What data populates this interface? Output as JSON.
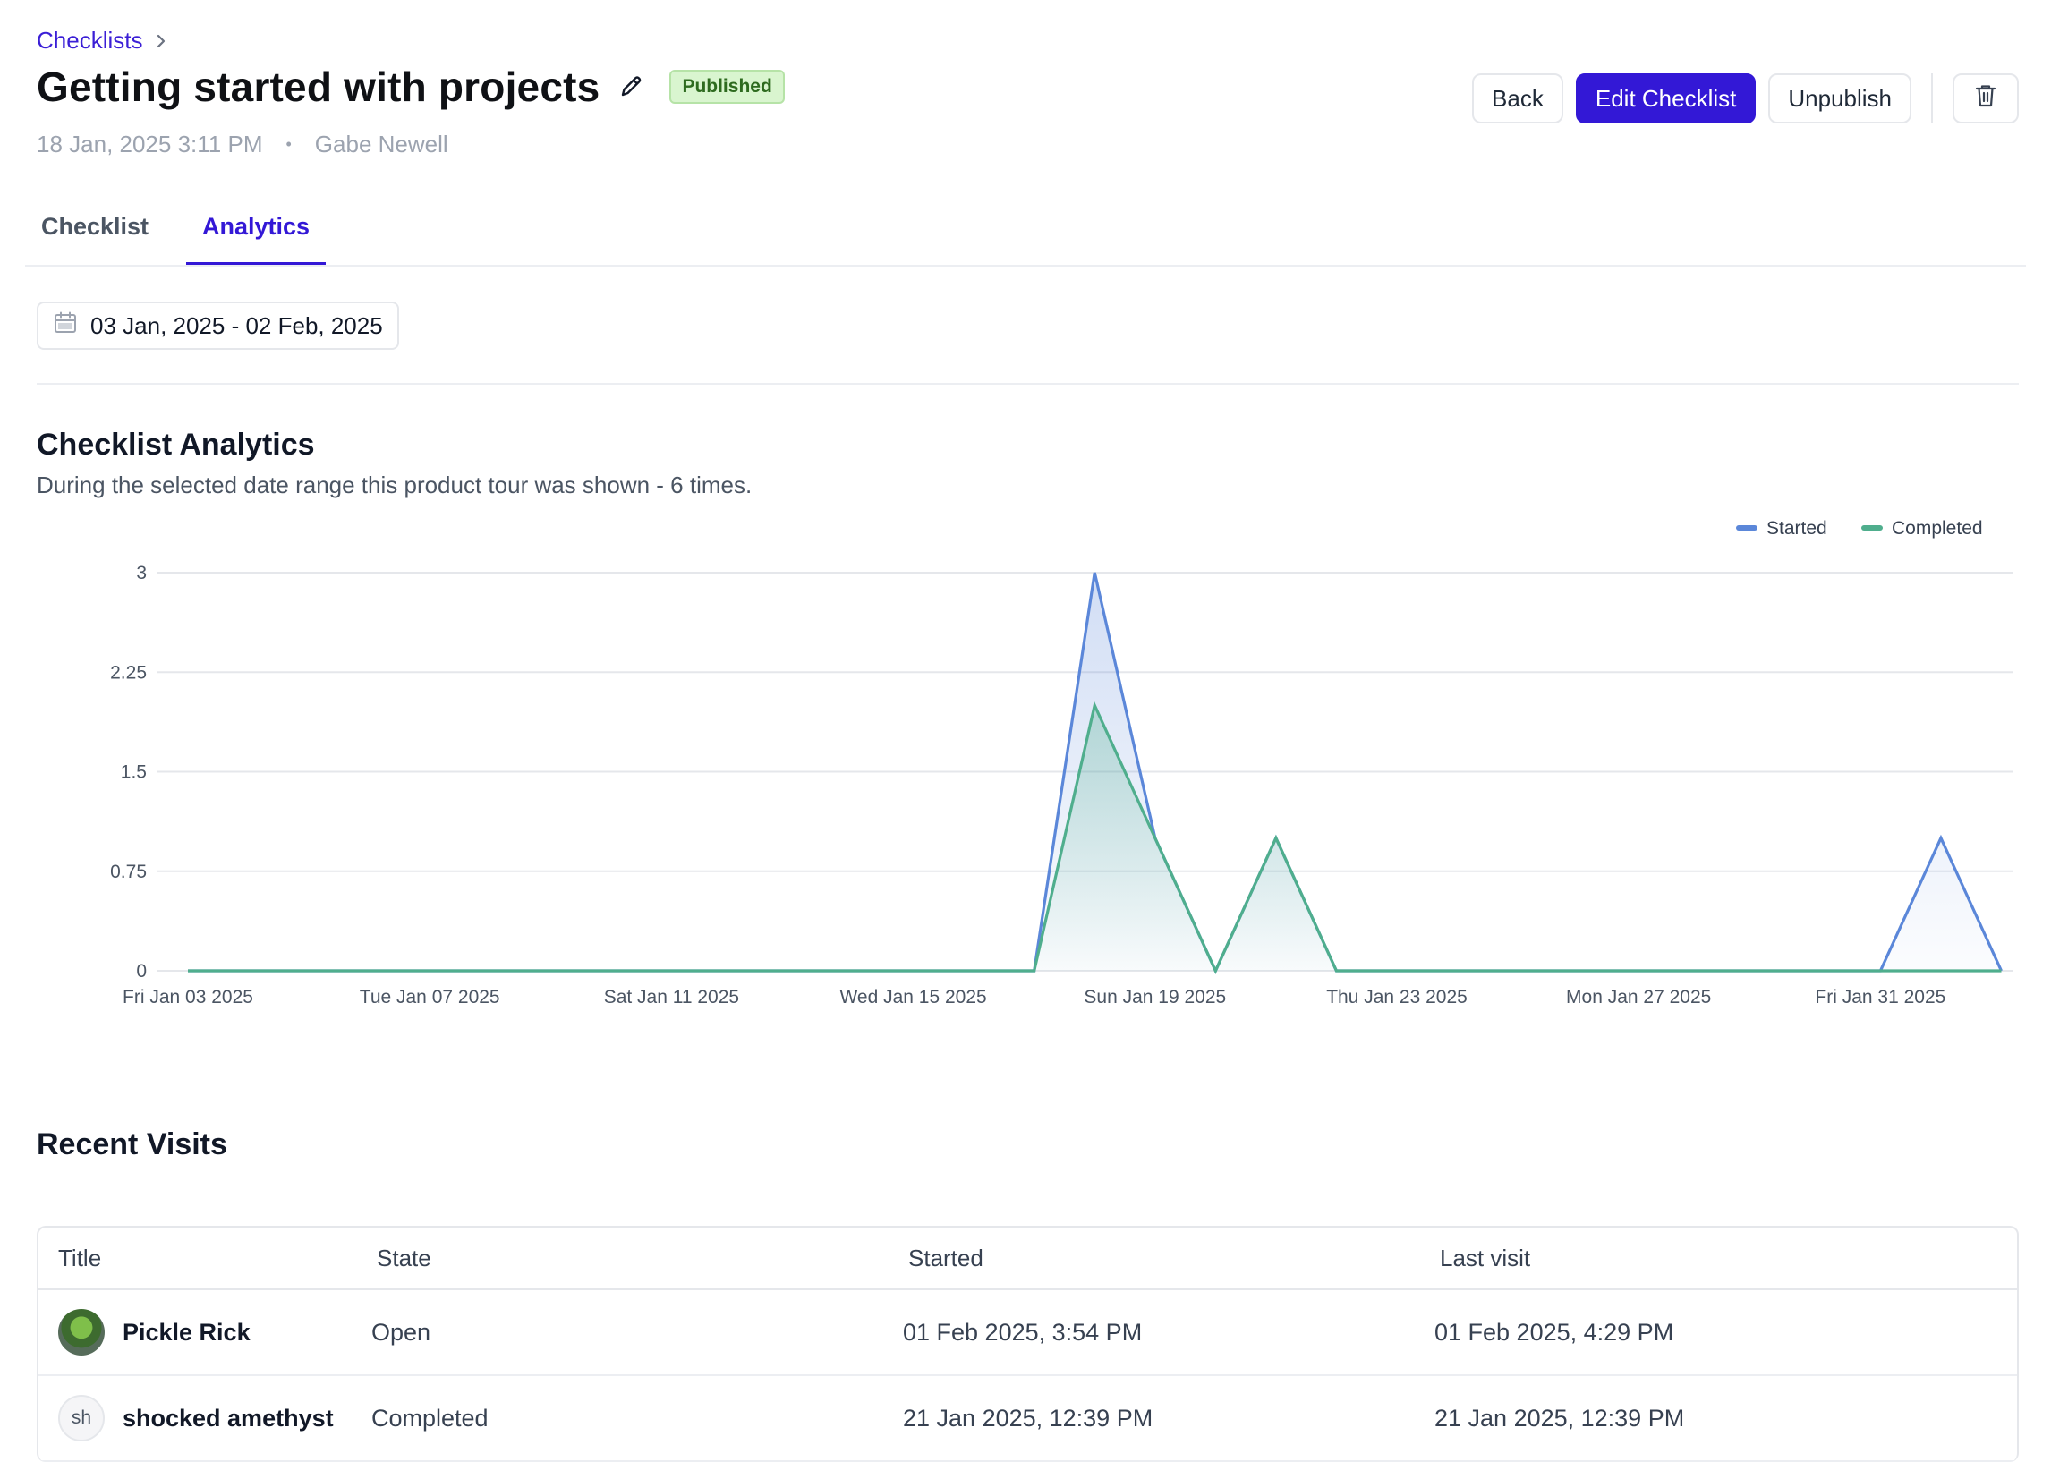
{
  "breadcrumb": {
    "label": "Checklists"
  },
  "header": {
    "title": "Getting started with projects",
    "status_badge": "Published",
    "date": "18 Jan, 2025 3:11 PM",
    "separator": "•",
    "author": "Gabe Newell"
  },
  "actions": {
    "back": "Back",
    "edit": "Edit Checklist",
    "unpublish": "Unpublish",
    "delete_icon": "trash-icon"
  },
  "tabs": [
    {
      "label": "Checklist",
      "active": false
    },
    {
      "label": "Analytics",
      "active": true
    }
  ],
  "date_range": {
    "value": "03 Jan, 2025 - 02 Feb, 2025",
    "icon": "calendar-icon"
  },
  "analytics": {
    "title": "Checklist Analytics",
    "subtitle": "During the selected date range this product tour was shown - 6 times."
  },
  "colors": {
    "accent": "#3318d6",
    "started": "#5b87d9",
    "completed": "#4fae8d"
  },
  "chart_data": {
    "type": "area",
    "x": [
      "2025-01-03",
      "2025-01-04",
      "2025-01-05",
      "2025-01-06",
      "2025-01-07",
      "2025-01-08",
      "2025-01-09",
      "2025-01-10",
      "2025-01-11",
      "2025-01-12",
      "2025-01-13",
      "2025-01-14",
      "2025-01-15",
      "2025-01-16",
      "2025-01-17",
      "2025-01-18",
      "2025-01-19",
      "2025-01-20",
      "2025-01-21",
      "2025-01-22",
      "2025-01-23",
      "2025-01-24",
      "2025-01-25",
      "2025-01-26",
      "2025-01-27",
      "2025-01-28",
      "2025-01-29",
      "2025-01-30",
      "2025-01-31",
      "2025-02-01",
      "2025-02-02"
    ],
    "x_tick_labels": [
      "Fri Jan 03 2025",
      "Tue Jan 07 2025",
      "Sat Jan 11 2025",
      "Wed Jan 15 2025",
      "Sun Jan 19 2025",
      "Thu Jan 23 2025",
      "Mon Jan 27 2025",
      "Fri Jan 31 2025"
    ],
    "series": [
      {
        "name": "Started",
        "values": [
          0,
          0,
          0,
          0,
          0,
          0,
          0,
          0,
          0,
          0,
          0,
          0,
          0,
          0,
          0,
          3,
          1,
          0,
          1,
          0,
          0,
          0,
          0,
          0,
          0,
          0,
          0,
          0,
          0,
          1,
          0
        ]
      },
      {
        "name": "Completed",
        "values": [
          0,
          0,
          0,
          0,
          0,
          0,
          0,
          0,
          0,
          0,
          0,
          0,
          0,
          0,
          0,
          2,
          1,
          0,
          1,
          0,
          0,
          0,
          0,
          0,
          0,
          0,
          0,
          0,
          0,
          0,
          0
        ]
      }
    ],
    "ylim": [
      0,
      3
    ],
    "y_ticks": [
      "3",
      "2.25",
      "1.5",
      "0.75",
      "0"
    ],
    "grid": true,
    "legend_position": "top-right"
  },
  "recent_visits": {
    "title": "Recent Visits",
    "columns": [
      "Title",
      "State",
      "Started",
      "Last visit"
    ],
    "rows": [
      {
        "avatar": "avatar-image",
        "avatar_text": "",
        "title": "Pickle Rick",
        "state": "Open",
        "started": "01 Feb 2025, 3:54 PM",
        "last_visit": "01 Feb 2025, 4:29 PM"
      },
      {
        "avatar": "initials",
        "avatar_text": "sh",
        "title": "shocked amethyst",
        "state": "Completed",
        "started": "21 Jan 2025, 12:39 PM",
        "last_visit": "21 Jan 2025, 12:39 PM"
      }
    ]
  }
}
